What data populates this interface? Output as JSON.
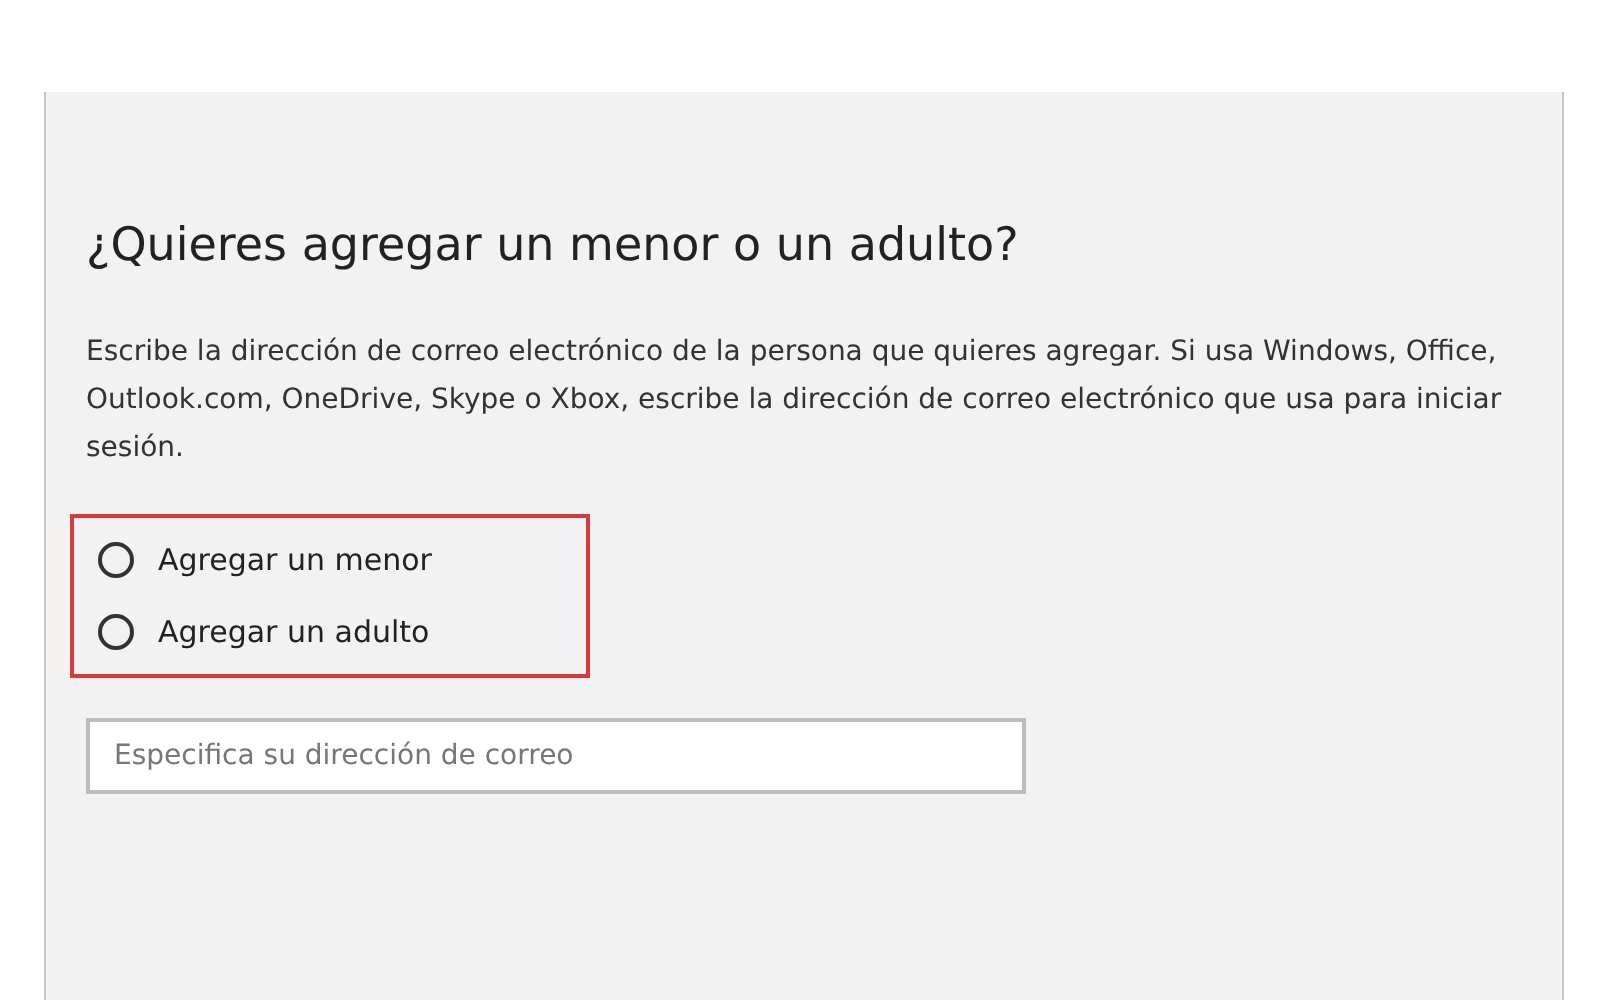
{
  "heading": "¿Quieres agregar un menor o un adulto?",
  "description": "Escribe la dirección de correo electrónico de la persona que quieres agregar. Si usa Windows, Office, Outlook.com, OneDrive, Skype o Xbox, escribe la dirección de correo electrónico que usa para iniciar sesión.",
  "options": [
    {
      "label": "Agregar un menor",
      "selected": false
    },
    {
      "label": "Agregar un adulto",
      "selected": false
    }
  ],
  "email_field": {
    "placeholder": "Especifica su dirección de correo"
  }
}
